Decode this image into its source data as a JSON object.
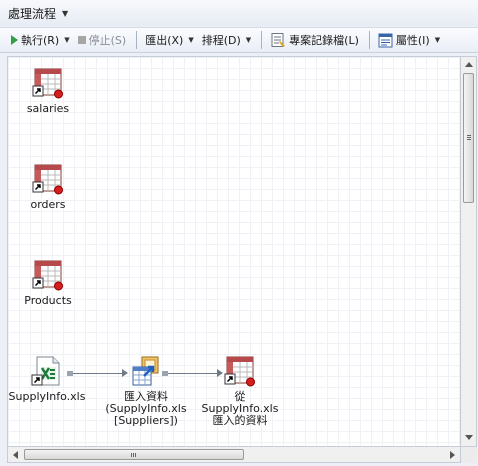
{
  "window": {
    "title": "處理流程"
  },
  "toolbar": {
    "run_label": "執行(R)",
    "stop_label": "停止(S)",
    "export_label": "匯出(X)",
    "schedule_label": "排程(D)",
    "project_log_label": "專案記錄檔(L)",
    "properties_label": "屬性(I)"
  },
  "nodes": {
    "salaries": {
      "label": "salaries",
      "icon": "data-table-icon"
    },
    "orders": {
      "label": "orders",
      "icon": "data-table-icon"
    },
    "products": {
      "label": "Products",
      "icon": "data-table-icon"
    },
    "supplyinfo": {
      "label": "SupplyInfo.xls",
      "icon": "excel-file-icon"
    },
    "import_data": {
      "label_lines": [
        "匯入資料",
        "(SupplyInfo.xls",
        "[Suppliers])"
      ],
      "icon": "import-data-icon"
    },
    "imported_result": {
      "label_lines": [
        "從",
        "SupplyInfo.xls",
        "匯入的資料"
      ],
      "icon": "data-table-icon"
    }
  },
  "colors": {
    "accent": "#2f6fbe",
    "run_green": "#2ea043",
    "error_red": "#d61e1e"
  }
}
